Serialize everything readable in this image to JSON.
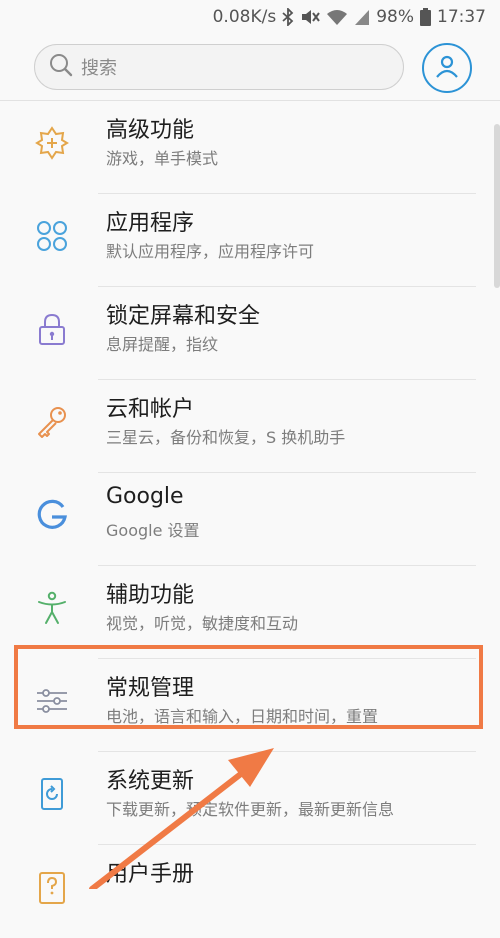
{
  "status_bar": {
    "speed": "0.08K/s",
    "battery": "98%",
    "time": "17:37"
  },
  "search": {
    "placeholder": "搜索"
  },
  "settings_items": [
    {
      "title": "高级功能",
      "subtitle": "游戏，单手模式",
      "icon": "advanced-features-icon"
    },
    {
      "title": "应用程序",
      "subtitle": "默认应用程序，应用程序许可",
      "icon": "apps-icon"
    },
    {
      "title": "锁定屏幕和安全",
      "subtitle": "息屏提醒，指纹",
      "icon": "lock-icon"
    },
    {
      "title": "云和帐户",
      "subtitle": "三星云，备份和恢复，S 换机助手",
      "icon": "key-icon"
    },
    {
      "title": "Google",
      "subtitle": "Google 设置",
      "icon": "google-icon"
    },
    {
      "title": "辅助功能",
      "subtitle": "视觉，听觉，敏捷度和互动",
      "icon": "accessibility-icon"
    },
    {
      "title": "常规管理",
      "subtitle": "电池，语言和输入，日期和时间，重置",
      "icon": "sliders-icon"
    },
    {
      "title": "系统更新",
      "subtitle": "下载更新，预定软件更新，最新更新信息",
      "icon": "system-update-icon"
    },
    {
      "title": "用户手册",
      "subtitle": "",
      "icon": "user-manual-icon"
    }
  ],
  "colors": {
    "highlight": "#f07a45",
    "profile_accent": "#2c93d6"
  }
}
